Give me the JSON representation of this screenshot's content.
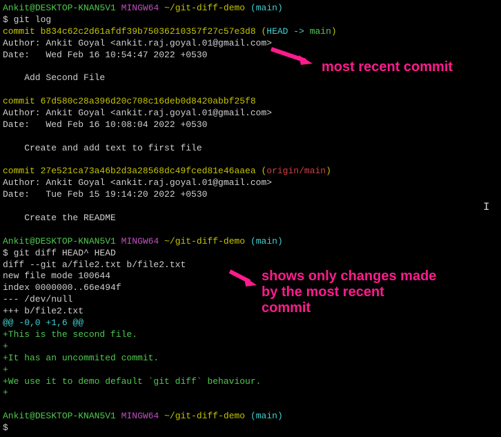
{
  "prompt1": {
    "user": "Ankit",
    "at": "@",
    "host": "DESKTOP-KNAN5V1",
    "sys": "MINGW64",
    "path": "~/git-diff-demo",
    "branch": "(main)"
  },
  "cmd1": "$ git log",
  "log": [
    {
      "prefix": "commit ",
      "hash": "b834c62c2d61afdf39b75036210357f27c57e3d8",
      "ref_open": " (",
      "head": "HEAD -> ",
      "branch": "main",
      "ref_close": ")"
    },
    {
      "author": "Author: Ankit Goyal <ankit.raj.goyal.01@gmail.com>"
    },
    {
      "date": "Date:   Wed Feb 16 10:54:47 2022 +0530"
    },
    {
      "blank": ""
    },
    {
      "msg": "    Add Second File"
    },
    {
      "blank": ""
    },
    {
      "prefix": "commit ",
      "hash": "67d580c28a396d20c708c16deb0d8420abbf25f8"
    },
    {
      "author": "Author: Ankit Goyal <ankit.raj.goyal.01@gmail.com>"
    },
    {
      "date": "Date:   Wed Feb 16 10:08:04 2022 +0530"
    },
    {
      "blank": ""
    },
    {
      "msg": "    Create and add text to first file"
    },
    {
      "blank": ""
    },
    {
      "prefix": "commit ",
      "hash": "27e521ca73a46b2d3a28568dc49fced81e46aaea",
      "ref_open": " (",
      "remote": "origin/main",
      "ref_close": ")"
    },
    {
      "author": "Author: Ankit Goyal <ankit.raj.goyal.01@gmail.com>"
    },
    {
      "date": "Date:   Tue Feb 15 19:14:20 2022 +0530"
    },
    {
      "blank": ""
    },
    {
      "msg": "    Create the README"
    }
  ],
  "cmd2": "$ git diff HEAD^ HEAD",
  "diff": {
    "header1": "diff --git a/file2.txt b/file2.txt",
    "header2": "new file mode 100644",
    "header3": "index 0000000..66e494f",
    "header4": "--- /dev/null",
    "header5": "+++ b/file2.txt",
    "hunk": "@@ -0,0 +1,6 @@",
    "add1": "+This is the second file.",
    "add2": "+",
    "add3": "+It has an uncommited commit.",
    "add4": "+",
    "add5": "+We use it to demo default `git diff` behaviour.",
    "add6": "+"
  },
  "cmd3": "$",
  "annot1": "most recent commit",
  "annot2_l1": "shows only changes made",
  "annot2_l2": "by the most recent",
  "annot2_l3": "commit"
}
